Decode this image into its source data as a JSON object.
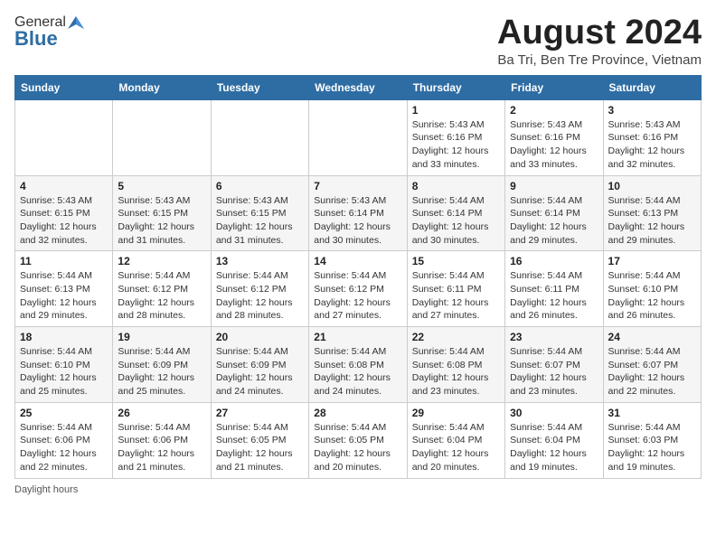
{
  "header": {
    "logo_general": "General",
    "logo_blue": "Blue",
    "title": "August 2024",
    "subtitle": "Ba Tri, Ben Tre Province, Vietnam"
  },
  "days_of_week": [
    "Sunday",
    "Monday",
    "Tuesday",
    "Wednesday",
    "Thursday",
    "Friday",
    "Saturday"
  ],
  "weeks": [
    [
      {
        "day": "",
        "detail": ""
      },
      {
        "day": "",
        "detail": ""
      },
      {
        "day": "",
        "detail": ""
      },
      {
        "day": "",
        "detail": ""
      },
      {
        "day": "1",
        "detail": "Sunrise: 5:43 AM\nSunset: 6:16 PM\nDaylight: 12 hours\nand 33 minutes."
      },
      {
        "day": "2",
        "detail": "Sunrise: 5:43 AM\nSunset: 6:16 PM\nDaylight: 12 hours\nand 33 minutes."
      },
      {
        "day": "3",
        "detail": "Sunrise: 5:43 AM\nSunset: 6:16 PM\nDaylight: 12 hours\nand 32 minutes."
      }
    ],
    [
      {
        "day": "4",
        "detail": "Sunrise: 5:43 AM\nSunset: 6:15 PM\nDaylight: 12 hours\nand 32 minutes."
      },
      {
        "day": "5",
        "detail": "Sunrise: 5:43 AM\nSunset: 6:15 PM\nDaylight: 12 hours\nand 31 minutes."
      },
      {
        "day": "6",
        "detail": "Sunrise: 5:43 AM\nSunset: 6:15 PM\nDaylight: 12 hours\nand 31 minutes."
      },
      {
        "day": "7",
        "detail": "Sunrise: 5:43 AM\nSunset: 6:14 PM\nDaylight: 12 hours\nand 30 minutes."
      },
      {
        "day": "8",
        "detail": "Sunrise: 5:44 AM\nSunset: 6:14 PM\nDaylight: 12 hours\nand 30 minutes."
      },
      {
        "day": "9",
        "detail": "Sunrise: 5:44 AM\nSunset: 6:14 PM\nDaylight: 12 hours\nand 29 minutes."
      },
      {
        "day": "10",
        "detail": "Sunrise: 5:44 AM\nSunset: 6:13 PM\nDaylight: 12 hours\nand 29 minutes."
      }
    ],
    [
      {
        "day": "11",
        "detail": "Sunrise: 5:44 AM\nSunset: 6:13 PM\nDaylight: 12 hours\nand 29 minutes."
      },
      {
        "day": "12",
        "detail": "Sunrise: 5:44 AM\nSunset: 6:12 PM\nDaylight: 12 hours\nand 28 minutes."
      },
      {
        "day": "13",
        "detail": "Sunrise: 5:44 AM\nSunset: 6:12 PM\nDaylight: 12 hours\nand 28 minutes."
      },
      {
        "day": "14",
        "detail": "Sunrise: 5:44 AM\nSunset: 6:12 PM\nDaylight: 12 hours\nand 27 minutes."
      },
      {
        "day": "15",
        "detail": "Sunrise: 5:44 AM\nSunset: 6:11 PM\nDaylight: 12 hours\nand 27 minutes."
      },
      {
        "day": "16",
        "detail": "Sunrise: 5:44 AM\nSunset: 6:11 PM\nDaylight: 12 hours\nand 26 minutes."
      },
      {
        "day": "17",
        "detail": "Sunrise: 5:44 AM\nSunset: 6:10 PM\nDaylight: 12 hours\nand 26 minutes."
      }
    ],
    [
      {
        "day": "18",
        "detail": "Sunrise: 5:44 AM\nSunset: 6:10 PM\nDaylight: 12 hours\nand 25 minutes."
      },
      {
        "day": "19",
        "detail": "Sunrise: 5:44 AM\nSunset: 6:09 PM\nDaylight: 12 hours\nand 25 minutes."
      },
      {
        "day": "20",
        "detail": "Sunrise: 5:44 AM\nSunset: 6:09 PM\nDaylight: 12 hours\nand 24 minutes."
      },
      {
        "day": "21",
        "detail": "Sunrise: 5:44 AM\nSunset: 6:08 PM\nDaylight: 12 hours\nand 24 minutes."
      },
      {
        "day": "22",
        "detail": "Sunrise: 5:44 AM\nSunset: 6:08 PM\nDaylight: 12 hours\nand 23 minutes."
      },
      {
        "day": "23",
        "detail": "Sunrise: 5:44 AM\nSunset: 6:07 PM\nDaylight: 12 hours\nand 23 minutes."
      },
      {
        "day": "24",
        "detail": "Sunrise: 5:44 AM\nSunset: 6:07 PM\nDaylight: 12 hours\nand 22 minutes."
      }
    ],
    [
      {
        "day": "25",
        "detail": "Sunrise: 5:44 AM\nSunset: 6:06 PM\nDaylight: 12 hours\nand 22 minutes."
      },
      {
        "day": "26",
        "detail": "Sunrise: 5:44 AM\nSunset: 6:06 PM\nDaylight: 12 hours\nand 21 minutes."
      },
      {
        "day": "27",
        "detail": "Sunrise: 5:44 AM\nSunset: 6:05 PM\nDaylight: 12 hours\nand 21 minutes."
      },
      {
        "day": "28",
        "detail": "Sunrise: 5:44 AM\nSunset: 6:05 PM\nDaylight: 12 hours\nand 20 minutes."
      },
      {
        "day": "29",
        "detail": "Sunrise: 5:44 AM\nSunset: 6:04 PM\nDaylight: 12 hours\nand 20 minutes."
      },
      {
        "day": "30",
        "detail": "Sunrise: 5:44 AM\nSunset: 6:04 PM\nDaylight: 12 hours\nand 19 minutes."
      },
      {
        "day": "31",
        "detail": "Sunrise: 5:44 AM\nSunset: 6:03 PM\nDaylight: 12 hours\nand 19 minutes."
      }
    ]
  ],
  "footer": "Daylight hours"
}
